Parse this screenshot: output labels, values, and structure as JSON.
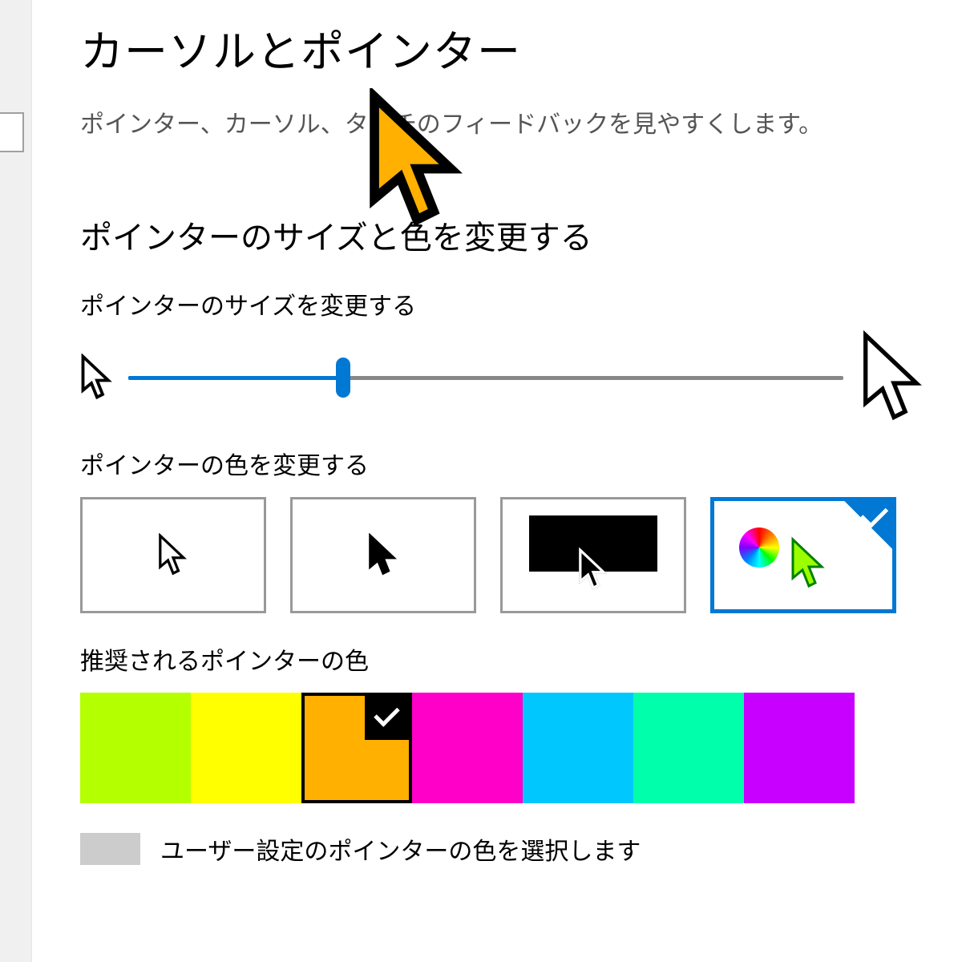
{
  "page": {
    "title": "カーソルとポインター",
    "subtitle": "ポインター、カーソル、タッチのフィードバックを見やすくします。"
  },
  "section": {
    "heading": "ポインターのサイズと色を変更する",
    "size_label": "ポインターのサイズを変更する",
    "color_label": "ポインターの色を変更する",
    "recommended_label": "推奨されるポインターの色",
    "custom_label": "ユーザー設定のポインターの色を選択します"
  },
  "slider": {
    "value_percent": 30
  },
  "color_options": {
    "selected_index": 3
  },
  "swatches": {
    "colors": [
      "#b4ff00",
      "#ffff00",
      "#ffb000",
      "#ff00c8",
      "#00c8ff",
      "#00ffaa",
      "#c800ff"
    ],
    "selected_index": 2
  },
  "big_cursor_color": "#ffb000"
}
